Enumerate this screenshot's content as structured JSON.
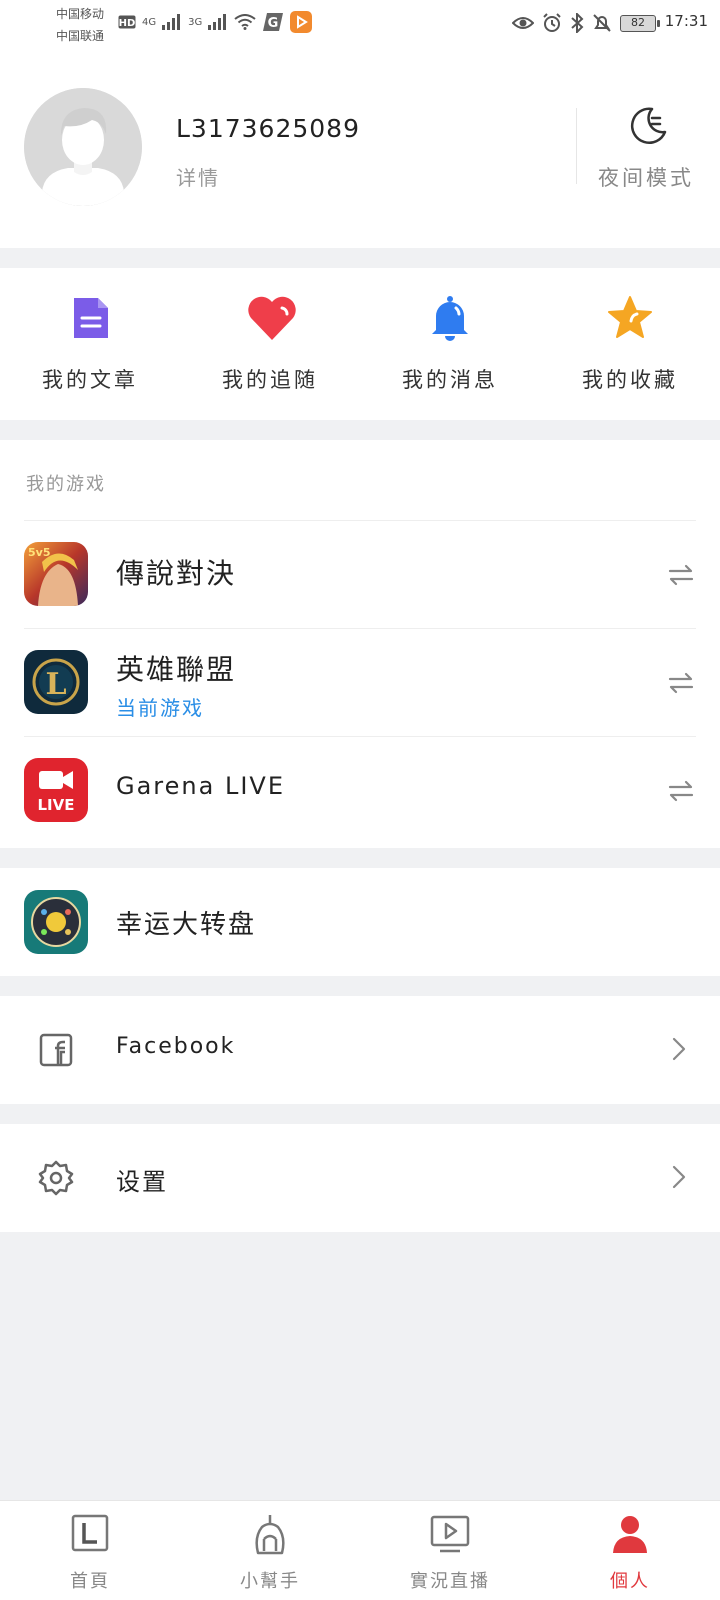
{
  "status_bar": {
    "carrier_1": "中国移动",
    "carrier_2": "中国联通",
    "net_1": "4G",
    "net_2": "3G",
    "battery": "82",
    "time": "17:31"
  },
  "profile": {
    "username": "L3173625089",
    "detail_label": "详情",
    "night_mode_label": "夜间模式"
  },
  "quick_actions": [
    {
      "label": "我的文章",
      "icon": "document-icon",
      "color": "#7b5ce8"
    },
    {
      "label": "我的追随",
      "icon": "heart-icon",
      "color": "#ef3e4a"
    },
    {
      "label": "我的消息",
      "icon": "bell-icon",
      "color": "#2f7cf0"
    },
    {
      "label": "我的收藏",
      "icon": "star-icon",
      "color": "#f5a623"
    }
  ],
  "games": {
    "section_title": "我的游戏",
    "items": [
      {
        "name": "傳說對決",
        "subtitle": ""
      },
      {
        "name": "英雄聯盟",
        "subtitle": "当前游戏"
      },
      {
        "name": "Garena LIVE",
        "subtitle": "",
        "icon_text": "LIVE"
      }
    ]
  },
  "lucky_wheel": {
    "label": "幸运大转盘"
  },
  "facebook": {
    "label": "Facebook"
  },
  "settings": {
    "label": "设置"
  },
  "bottom_nav": [
    {
      "label": "首頁",
      "icon": "home-icon",
      "active": false
    },
    {
      "label": "小幫手",
      "icon": "helper-icon",
      "active": false
    },
    {
      "label": "實況直播",
      "icon": "live-play-icon",
      "active": false
    },
    {
      "label": "個人",
      "icon": "person-icon",
      "active": true
    }
  ],
  "colors": {
    "accent_red": "#e0393e",
    "link_blue": "#2a8ee6",
    "page_background": "#f0f1f3"
  }
}
